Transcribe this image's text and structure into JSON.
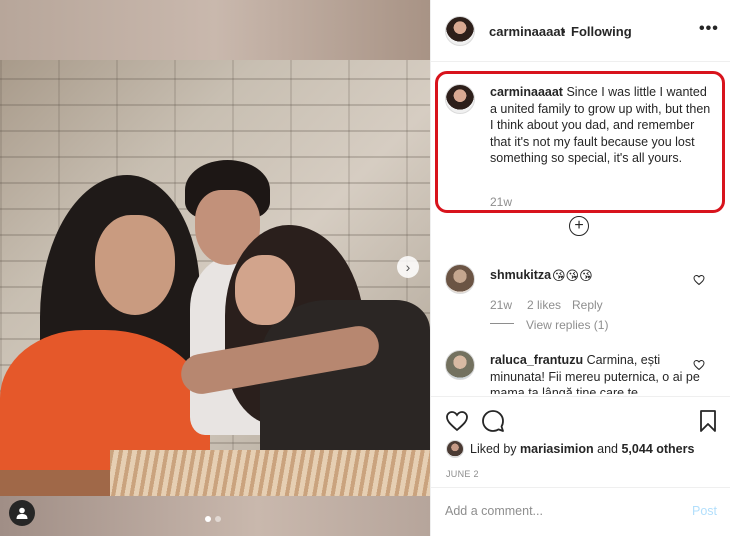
{
  "header": {
    "username": "carminaaaat",
    "separator": "•",
    "follow_status": "Following",
    "more_glyph": "•••"
  },
  "caption": {
    "username": "carminaaaat",
    "text": "Since I was little I wanted a united family to grow up with, but then I think about you dad, and remember that it's not my fault because you lost something so special, it's all yours.",
    "time": "21w",
    "highlight_color": "#d8131c"
  },
  "load_more_glyph": "+",
  "comments": [
    {
      "username": "shmukitza",
      "text": "😘😘😘",
      "time": "21w",
      "likes": "2 likes",
      "reply": "Reply",
      "view_replies": "View replies (1)"
    },
    {
      "username": "raluca_frantuzu",
      "text": "Carmina, ești minunata! Fii mereu puternica, o ai pe mama ta lângă tine care te"
    }
  ],
  "likes": {
    "prefix": "Liked by ",
    "user": "mariasimion",
    "middle": " and ",
    "count": "5,044 others"
  },
  "date": "JUNE 2",
  "add_comment": {
    "placeholder": "Add a comment...",
    "post_label": "Post"
  },
  "carousel": {
    "current": 1,
    "total": 2,
    "next_glyph": "›"
  },
  "icons": {
    "user_tag": "user-tag-icon",
    "heart": "heart-icon",
    "comment": "comment-icon",
    "save": "bookmark-icon"
  },
  "colors": {
    "link_blue_disabled": "#b2dffc",
    "muted": "#8e8e8e",
    "text": "#262626"
  }
}
